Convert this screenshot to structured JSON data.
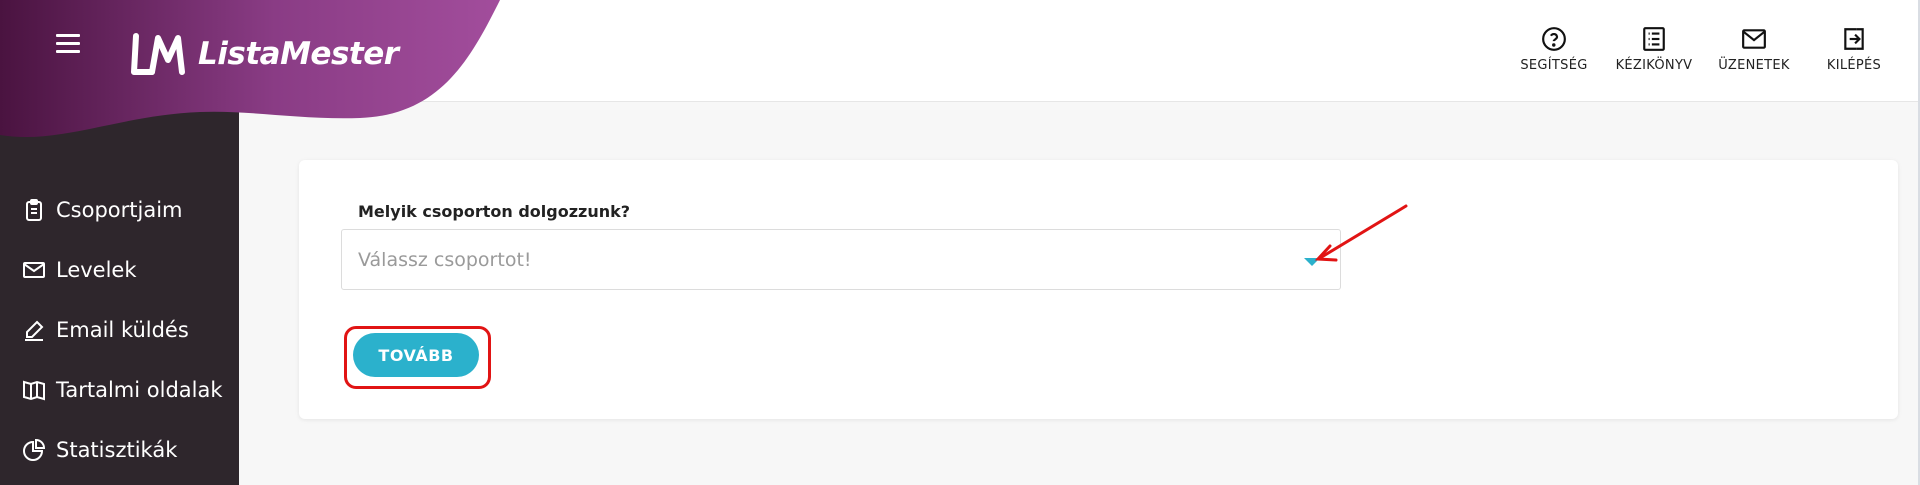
{
  "app": {
    "logo_text": "ListaMester"
  },
  "colors": {
    "brand_purple": "#a24d9c",
    "brand_dark": "#4a1340",
    "accent": "#2bb1cc",
    "sidebar_bg": "#2e262c",
    "highlight_red": "#e11414"
  },
  "header": {
    "actions": [
      {
        "label": "SEGÍTSÉG",
        "icon": "help-circle-icon"
      },
      {
        "label": "KÉZIKÖNYV",
        "icon": "list-document-icon"
      },
      {
        "label": "ÜZENETEK",
        "icon": "mail-icon"
      },
      {
        "label": "KILÉPÉS",
        "icon": "logout-icon"
      }
    ]
  },
  "sidebar": {
    "items": [
      {
        "label": "Csoportjaim",
        "icon": "clipboard-icon"
      },
      {
        "label": "Levelek",
        "icon": "envelope-icon"
      },
      {
        "label": "Email küldés",
        "icon": "pencil-icon"
      },
      {
        "label": "Tartalmi oldalak",
        "icon": "book-icon"
      },
      {
        "label": "Statisztikák",
        "icon": "pie-chart-icon"
      }
    ]
  },
  "form": {
    "label": "Melyik csoporton dolgozzunk?",
    "select_placeholder": "Válassz csoportot!",
    "next_button": "TOVÁBB"
  }
}
